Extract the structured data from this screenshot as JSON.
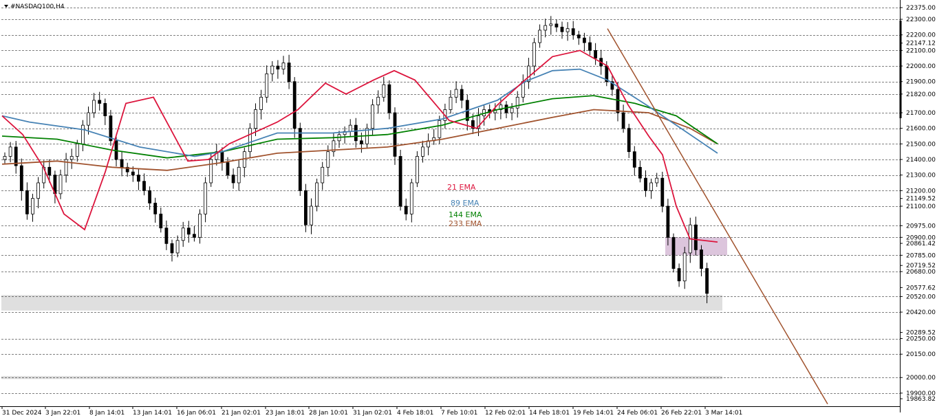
{
  "symbol": {
    "title": "#NASDAQ100,H4"
  },
  "chart_data": {
    "type": "candlestick",
    "symbol": "#NASDAQ100,H4",
    "ylim": [
      19820,
      22415
    ],
    "yticks": [
      {
        "value": 22375.0,
        "label": "22375.00",
        "boxed": false
      },
      {
        "value": 22300.0,
        "label": "22300.00",
        "boxed": false
      },
      {
        "value": 22200.0,
        "label": "22200.00",
        "boxed": false
      },
      {
        "value": 22147.12,
        "label": "22147.12",
        "boxed": false,
        "unlined": true
      },
      {
        "value": 22100.0,
        "label": "22100.00",
        "boxed": false
      },
      {
        "value": 22000.0,
        "label": "22000.00",
        "boxed": false
      },
      {
        "value": 21900.0,
        "label": "21900.00",
        "boxed": false
      },
      {
        "value": 21820.0,
        "label": "21820.00",
        "boxed": false
      },
      {
        "value": 21700.0,
        "label": "21700.00",
        "boxed": false
      },
      {
        "value": 21600.0,
        "label": "21600.00",
        "boxed": false
      },
      {
        "value": 21500.0,
        "label": "21500.00",
        "boxed": false
      },
      {
        "value": 21400.0,
        "label": "21400.00",
        "boxed": false
      },
      {
        "value": 21300.0,
        "label": "21300.00",
        "boxed": false
      },
      {
        "value": 21200.0,
        "label": "21200.00",
        "boxed": false
      },
      {
        "value": 21149.52,
        "label": "21149.52",
        "boxed": false,
        "unlined": true
      },
      {
        "value": 21100.0,
        "label": "21100.00",
        "boxed": false
      },
      {
        "value": 20975.0,
        "label": "20975.00",
        "boxed": false
      },
      {
        "value": 20900.0,
        "label": "20900.00",
        "boxed": false
      },
      {
        "value": 20861.42,
        "label": "20861.42",
        "boxed": false,
        "unlined": true
      },
      {
        "value": 20785.0,
        "label": "20785.00",
        "boxed": false
      },
      {
        "value": 20719.52,
        "label": "20719.52",
        "boxed": false,
        "unlined": true
      },
      {
        "value": 20680.0,
        "label": "20680.00",
        "boxed": false
      },
      {
        "value": 20577.62,
        "label": "20577.62",
        "boxed": false,
        "unlined": true
      },
      {
        "value": 20520.0,
        "label": "20520.00",
        "boxed": false
      },
      {
        "value": 20420.0,
        "label": "20420.00",
        "boxed": false
      },
      {
        "value": 20289.52,
        "label": "20289.52",
        "boxed": false,
        "unlined": true
      },
      {
        "value": 20250.0,
        "label": "20250.00",
        "boxed": false
      },
      {
        "value": 20150.0,
        "label": "20150.00",
        "boxed": false
      },
      {
        "value": 20000.0,
        "label": "20000.00",
        "boxed": false
      },
      {
        "value": 19900.0,
        "label": "19900.00",
        "boxed": false
      },
      {
        "value": 19863.82,
        "label": "19863.82",
        "boxed": false,
        "unlined": true
      }
    ],
    "xticks": [
      "31 Dec 2024",
      "3 Jan 22:01",
      "8 Jan 14:01",
      "13 Jan 14:01",
      "16 Jan 06:01",
      "21 Jan 02:01",
      "23 Jan 18:01",
      "28 Jan 10:01",
      "31 Jan 02:01",
      "4 Feb 18:01",
      "7 Feb 10:01",
      "12 Feb 02:01",
      "14 Feb 18:01",
      "19 Feb 14:01",
      "24 Feb 06:01",
      "26 Feb 22:01",
      "3 Mar 14:01"
    ],
    "legend": [
      {
        "name": "21 EMA",
        "color": "#dc143c"
      },
      {
        "name": "89 EMA",
        "color": "#4682b4"
      },
      {
        "name": "144 EMA",
        "color": "#008000"
      },
      {
        "name": "233 EMA",
        "color": "#a0522d"
      }
    ],
    "closes": [
      21420,
      21480,
      21360,
      21200,
      21050,
      21150,
      21250,
      21350,
      21300,
      21180,
      21300,
      21400,
      21420,
      21500,
      21620,
      21700,
      21780,
      21760,
      21680,
      21520,
      21400,
      21350,
      21320,
      21300,
      21260,
      21200,
      21120,
      21050,
      20960,
      20860,
      20800,
      20880,
      20960,
      20920,
      20900,
      21050,
      21250,
      21400,
      21450,
      21380,
      21300,
      21250,
      21350,
      21450,
      21600,
      21720,
      21800,
      21950,
      22000,
      21980,
      22020,
      21900,
      21600,
      21200,
      20980,
      21100,
      21250,
      21350,
      21450,
      21520,
      21560,
      21580,
      21620,
      21520,
      21500,
      21600,
      21750,
      21800,
      21880,
      21700,
      21420,
      21100,
      21050,
      21250,
      21420,
      21480,
      21520,
      21540,
      21650,
      21720,
      21800,
      21850,
      21780,
      21650,
      21600,
      21680,
      21720,
      21700,
      21720,
      21750,
      21700,
      21730,
      21800,
      21900,
      22000,
      22150,
      22230,
      22260,
      22270,
      22250,
      22220,
      22240,
      22200,
      22180,
      22150,
      22100,
      22050,
      22000,
      21900,
      21850,
      21700,
      21600,
      21450,
      21350,
      21280,
      21200,
      21250,
      21280,
      21100,
      20900,
      20700,
      20620,
      20800,
      20980,
      20820,
      20700,
      20540
    ],
    "ema21_label": "21 EMA",
    "ema89_label": "89 EMA",
    "ema144_label": "144 EMA",
    "ema233_label": "233 EMA",
    "ema21": [
      [
        0,
        21680
      ],
      [
        15,
        21560
      ],
      [
        30,
        21350
      ],
      [
        45,
        21050
      ],
      [
        60,
        20950
      ],
      [
        75,
        21320
      ],
      [
        90,
        21760
      ],
      [
        110,
        21800
      ],
      [
        135,
        21390
      ],
      [
        150,
        21400
      ],
      [
        165,
        21500
      ],
      [
        180,
        21560
      ],
      [
        200,
        21640
      ],
      [
        215,
        21720
      ],
      [
        235,
        21890
      ],
      [
        250,
        21820
      ],
      [
        270,
        21910
      ],
      [
        285,
        21970
      ],
      [
        300,
        21910
      ],
      [
        325,
        21650
      ],
      [
        345,
        21600
      ],
      [
        360,
        21750
      ],
      [
        380,
        21910
      ],
      [
        400,
        22060
      ],
      [
        420,
        22100
      ],
      [
        440,
        22000
      ],
      [
        455,
        21750
      ],
      [
        470,
        21550
      ],
      [
        480,
        21430
      ],
      [
        490,
        21100
      ],
      [
        500,
        20890
      ],
      [
        520,
        20870
      ]
    ],
    "ema89": [
      [
        0,
        21680
      ],
      [
        20,
        21640
      ],
      [
        60,
        21590
      ],
      [
        100,
        21480
      ],
      [
        140,
        21420
      ],
      [
        160,
        21450
      ],
      [
        200,
        21570
      ],
      [
        240,
        21570
      ],
      [
        280,
        21600
      ],
      [
        320,
        21660
      ],
      [
        360,
        21780
      ],
      [
        380,
        21900
      ],
      [
        400,
        21970
      ],
      [
        420,
        21980
      ],
      [
        440,
        21910
      ],
      [
        470,
        21740
      ],
      [
        490,
        21620
      ],
      [
        520,
        21440
      ]
    ],
    "ema144": [
      [
        0,
        21550
      ],
      [
        40,
        21530
      ],
      [
        80,
        21460
      ],
      [
        120,
        21410
      ],
      [
        160,
        21450
      ],
      [
        200,
        21530
      ],
      [
        240,
        21540
      ],
      [
        280,
        21560
      ],
      [
        320,
        21620
      ],
      [
        360,
        21720
      ],
      [
        400,
        21790
      ],
      [
        430,
        21810
      ],
      [
        460,
        21760
      ],
      [
        490,
        21680
      ],
      [
        520,
        21500
      ]
    ],
    "ema233": [
      [
        0,
        21370
      ],
      [
        40,
        21390
      ],
      [
        80,
        21350
      ],
      [
        120,
        21330
      ],
      [
        160,
        21380
      ],
      [
        200,
        21440
      ],
      [
        240,
        21460
      ],
      [
        280,
        21480
      ],
      [
        320,
        21530
      ],
      [
        360,
        21600
      ],
      [
        400,
        21670
      ],
      [
        430,
        21720
      ],
      [
        470,
        21700
      ],
      [
        500,
        21600
      ],
      [
        520,
        21500
      ]
    ],
    "trendline": {
      "from": [
        440,
        22240
      ],
      "to": [
        600,
        19830
      ],
      "color": "#a0522d"
    },
    "support_zones": [
      {
        "from_value": 20430,
        "to_value": 20530,
        "color": "#d9d9d9"
      },
      {
        "from_value": 19990,
        "to_value": 20010,
        "color": "#d9d9d9"
      }
    ],
    "resistance_zones": [
      {
        "x_from": 482,
        "x_to": 527,
        "from_value": 20785,
        "to_value": 20900,
        "color": "#d8bfd8"
      }
    ]
  }
}
